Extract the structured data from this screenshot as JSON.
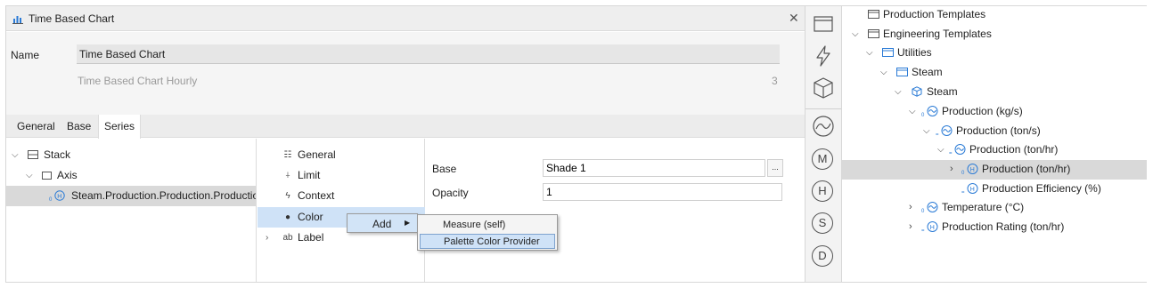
{
  "window": {
    "title": "Time Based Chart"
  },
  "properties": {
    "name_label": "Name",
    "name_value": "Time Based Chart",
    "description": "Time Based Chart Hourly",
    "count": "3"
  },
  "tabs": [
    "General",
    "Base",
    "Series"
  ],
  "series_tree": {
    "stack": "Stack",
    "axis": "Axis",
    "series_item": "Steam.Production.Production.Production (t"
  },
  "series_menu": [
    {
      "icon": "list-icon",
      "label": "General"
    },
    {
      "icon": "limit-icon",
      "label": "Limit"
    },
    {
      "icon": "lightning-icon",
      "label": "Context"
    },
    {
      "icon": "dot-icon",
      "label": "Color"
    },
    {
      "icon": "ab-icon",
      "label": "Label"
    }
  ],
  "series_icons": {
    "general": "☷",
    "limit": "⍭",
    "context": "ϟ",
    "color": "●",
    "label": "ab"
  },
  "detail": {
    "base_label": "Base",
    "base_value": "Shade 1",
    "ellipsis": "...",
    "opacity_label": "Opacity",
    "opacity_value": "1"
  },
  "context_menu": {
    "add_label": "Add",
    "submenu": [
      "Measure (self)",
      "Palette Color Provider"
    ]
  },
  "toolbar": {
    "circle_buttons": [
      "M",
      "H",
      "S",
      "D"
    ]
  },
  "right_tree": [
    {
      "label": "Production Templates",
      "icon": "folder-icon"
    },
    {
      "label": "Engineering Templates",
      "icon": "folder-icon"
    },
    {
      "label": "Utilities",
      "icon": "folder-blue-icon"
    },
    {
      "label": "Steam",
      "icon": "folder-blue-icon"
    },
    {
      "label": "Steam",
      "icon": "cube-icon"
    },
    {
      "label": "Production (kg/s)",
      "icon": "measure-icon"
    },
    {
      "label": "Production (ton/s)",
      "icon": "measure-icon"
    },
    {
      "label": "Production (ton/hr)",
      "icon": "measure-icon"
    },
    {
      "label": "Production (ton/hr)",
      "icon": "measure-h-icon"
    },
    {
      "label": "Production Efficiency (%)",
      "icon": "measure-h-icon"
    },
    {
      "label": "Temperature (°C)",
      "icon": "measure-icon"
    },
    {
      "label": "Production Rating (ton/hr)",
      "icon": "measure-h-icon"
    }
  ],
  "colors": {
    "accent": "#2b7bd6",
    "selection": "#d9d9d9",
    "menu_highlight": "#cfe2f7"
  }
}
